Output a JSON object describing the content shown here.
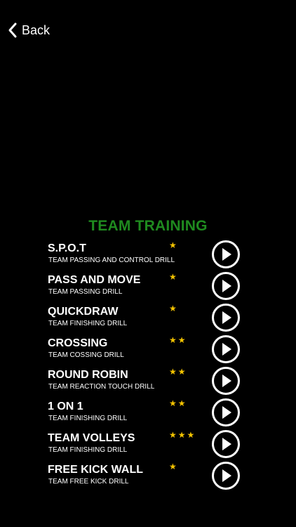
{
  "nav": {
    "back_label": "Back"
  },
  "section": {
    "title": "TEAM TRAINING"
  },
  "colors": {
    "title": "#1f8a1f",
    "stars": "#f5c400",
    "background": "#000000",
    "text": "#ffffff"
  },
  "icons": {
    "back": "chevron-left-icon",
    "play": "play-icon",
    "rating": "star"
  },
  "drills": [
    {
      "name": "S.P.O.T",
      "description": "TEAM PASSING AND CONTROL DRILL",
      "stars": "★",
      "rating": 1
    },
    {
      "name": "PASS AND MOVE",
      "description": "TEAM PASSING DRILL",
      "stars": "★",
      "rating": 1
    },
    {
      "name": "QUICKDRAW",
      "description": "TEAM FINISHING DRILL",
      "stars": "★",
      "rating": 1
    },
    {
      "name": "CROSSING",
      "description": "TEAM COSSING DRILL",
      "stars": "★★",
      "rating": 2
    },
    {
      "name": "ROUND ROBIN",
      "description": "TEAM REACTION TOUCH DRILL",
      "stars": "★★",
      "rating": 2
    },
    {
      "name": "1 ON 1",
      "description": "TEAM FINISHING DRILL",
      "stars": "★★",
      "rating": 2
    },
    {
      "name": "TEAM VOLLEYS",
      "description": "TEAM FINISHING DRILL",
      "stars": "★★★",
      "rating": 3
    },
    {
      "name": "FREE KICK WALL",
      "description": "TEAM FREE KICK DRILL",
      "stars": "★",
      "rating": 1
    }
  ]
}
